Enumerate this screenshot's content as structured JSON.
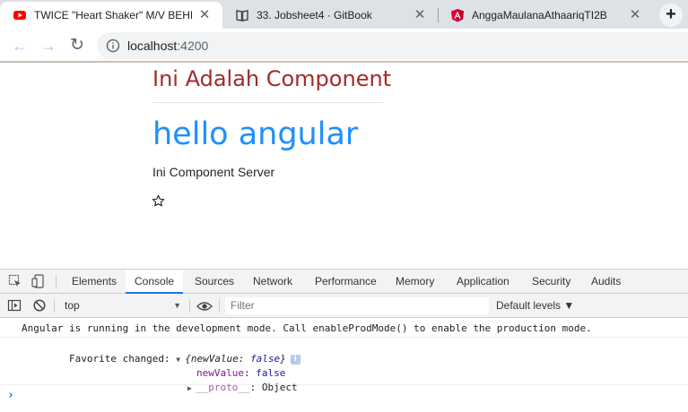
{
  "browser": {
    "tabs": [
      {
        "title": "TWICE \"Heart Shaker\" M/V BEHIN",
        "icon": "youtube-icon"
      },
      {
        "title": "33. Jobsheet4 · GitBook",
        "icon": "book-icon"
      },
      {
        "title": "AnggaMaulanaAthaariqTI2B",
        "icon": "angular-icon"
      }
    ],
    "close_glyph": "✕",
    "new_tab_glyph": "+",
    "address": {
      "host": "localhost",
      "port": ":4200"
    },
    "nav": {
      "back": "←",
      "forward": "→",
      "reload": "↻"
    }
  },
  "page": {
    "component_title": "Ini Adalah Component",
    "heading": "hello angular",
    "server_text": "Ini Component Server",
    "favorite_icon": "star-outline-icon"
  },
  "devtools": {
    "tabs": [
      "Elements",
      "Console",
      "Sources",
      "Network",
      "Performance",
      "Memory",
      "Application",
      "Security",
      "Audits"
    ],
    "active_tab": "Console",
    "context": "top",
    "filter_placeholder": "Filter",
    "levels": "Default levels ▼",
    "console": {
      "line1": "Angular is running in the development mode. Call enableProdMode() to enable the production mode.",
      "line2_label": "Favorite changed: ",
      "line2_obj_open": "{newValue: ",
      "line2_obj_val": "false",
      "line2_obj_close": "}",
      "info_badge": "i",
      "prop_name": "newValue",
      "prop_sep": ": ",
      "prop_val": "false",
      "proto_name": "__proto__",
      "proto_val": ": Object",
      "prompt": "›"
    }
  },
  "colors": {
    "component_title": "#a52a2a",
    "heading": "#1e90ff",
    "active_tab_underline": "#1a73e8"
  }
}
